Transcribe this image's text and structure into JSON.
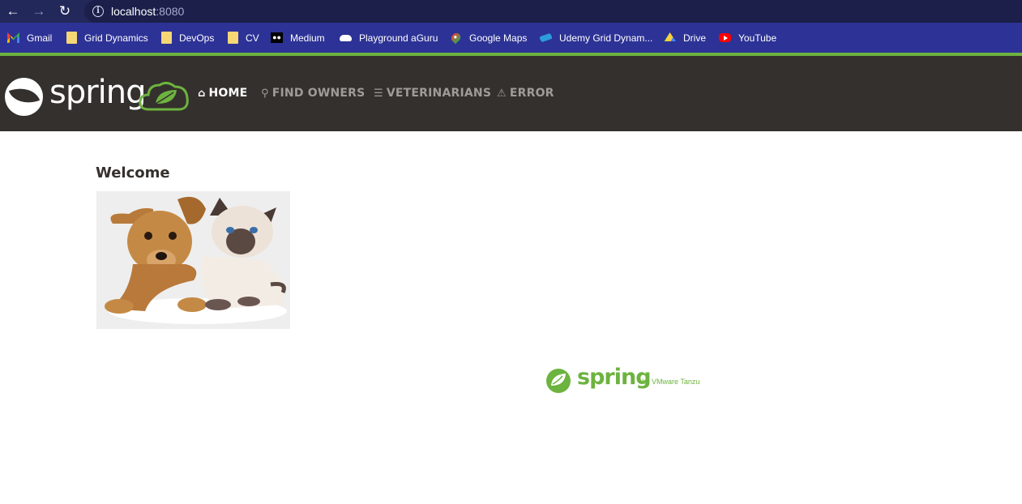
{
  "browser": {
    "back_icon": "arrow-left-icon",
    "forward_icon": "arrow-right-icon",
    "reload_icon": "reload-icon",
    "url_host": "localhost",
    "url_port": ":8080",
    "bookmarks": [
      {
        "label": "Gmail",
        "icon": "gmail-icon"
      },
      {
        "label": "Grid Dynamics",
        "icon": "folder-icon"
      },
      {
        "label": "DevOps",
        "icon": "folder-icon"
      },
      {
        "label": "CV",
        "icon": "folder-icon"
      },
      {
        "label": "Medium",
        "icon": "medium-icon"
      },
      {
        "label": "Playground aGuru",
        "icon": "cloud-icon"
      },
      {
        "label": "Google Maps",
        "icon": "maps-icon"
      },
      {
        "label": "Udemy Grid Dynam...",
        "icon": "udemy-icon"
      },
      {
        "label": "Drive",
        "icon": "drive-icon"
      },
      {
        "label": "YouTube",
        "icon": "youtube-icon"
      }
    ]
  },
  "navbar": {
    "brand": "spring",
    "items": [
      {
        "label": "HOME",
        "icon": "home-icon",
        "active": true
      },
      {
        "label": "FIND OWNERS",
        "icon": "search-icon",
        "active": false
      },
      {
        "label": "VETERINARIANS",
        "icon": "list-icon",
        "active": false
      },
      {
        "label": "ERROR",
        "icon": "warning-icon",
        "active": false
      }
    ]
  },
  "main": {
    "title": "Welcome",
    "image": "pets-image"
  },
  "footer": {
    "brand": "spring",
    "tagline": "by VMware Tanzu"
  },
  "colors": {
    "spring_green": "#6db33f",
    "navbar_bg": "#34302d",
    "browser_bar": "#23285b",
    "bookmarks_bar": "#2d3296"
  }
}
